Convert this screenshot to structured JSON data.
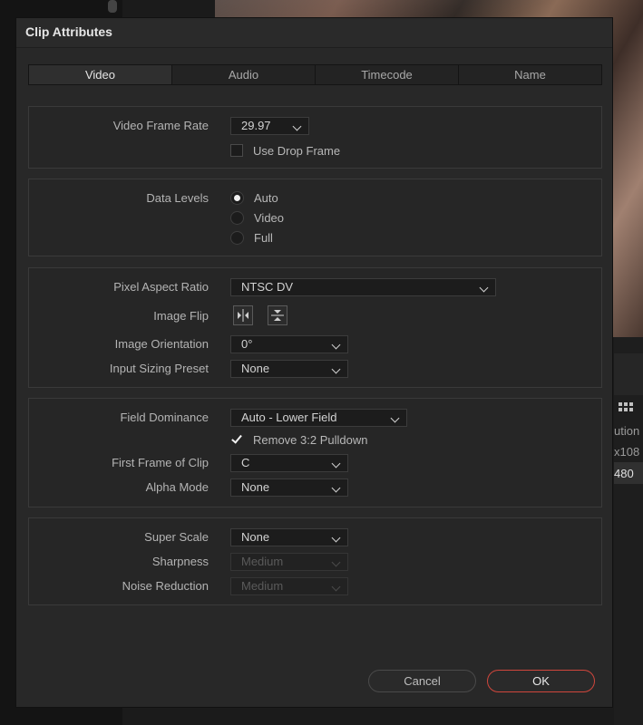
{
  "background": {
    "grid_icon": "grid-icon",
    "col_fragment": "ution",
    "res_fragment": "x108",
    "row_value": "480"
  },
  "dialog": {
    "title": "Clip Attributes",
    "tabs": [
      {
        "label": "Video",
        "active": true
      },
      {
        "label": "Audio",
        "active": false
      },
      {
        "label": "Timecode",
        "active": false
      },
      {
        "label": "Name",
        "active": false
      }
    ]
  },
  "frame_rate": {
    "label": "Video Frame Rate",
    "value": "29.97",
    "drop_frame_label": "Use Drop Frame",
    "drop_frame_checked": false
  },
  "data_levels": {
    "label": "Data Levels",
    "options": [
      "Auto",
      "Video",
      "Full"
    ],
    "selected": "Auto"
  },
  "pixel": {
    "aspect_label": "Pixel Aspect Ratio",
    "aspect_value": "NTSC DV",
    "flip_label": "Image Flip",
    "orientation_label": "Image Orientation",
    "orientation_value": "0°",
    "sizing_label": "Input Sizing Preset",
    "sizing_value": "None"
  },
  "field": {
    "dominance_label": "Field Dominance",
    "dominance_value": "Auto - Lower Field",
    "pulldown_label": "Remove 3:2 Pulldown",
    "pulldown_checked": true,
    "first_frame_label": "First Frame of Clip",
    "first_frame_value": "C",
    "alpha_label": "Alpha Mode",
    "alpha_value": "None"
  },
  "scale": {
    "super_scale_label": "Super Scale",
    "super_scale_value": "None",
    "sharpness_label": "Sharpness",
    "sharpness_value": "Medium",
    "noise_label": "Noise Reduction",
    "noise_value": "Medium"
  },
  "buttons": {
    "cancel": "Cancel",
    "ok": "OK"
  },
  "colors": {
    "accent_ok_border": "#d0463c",
    "dialog_bg": "#282828"
  }
}
